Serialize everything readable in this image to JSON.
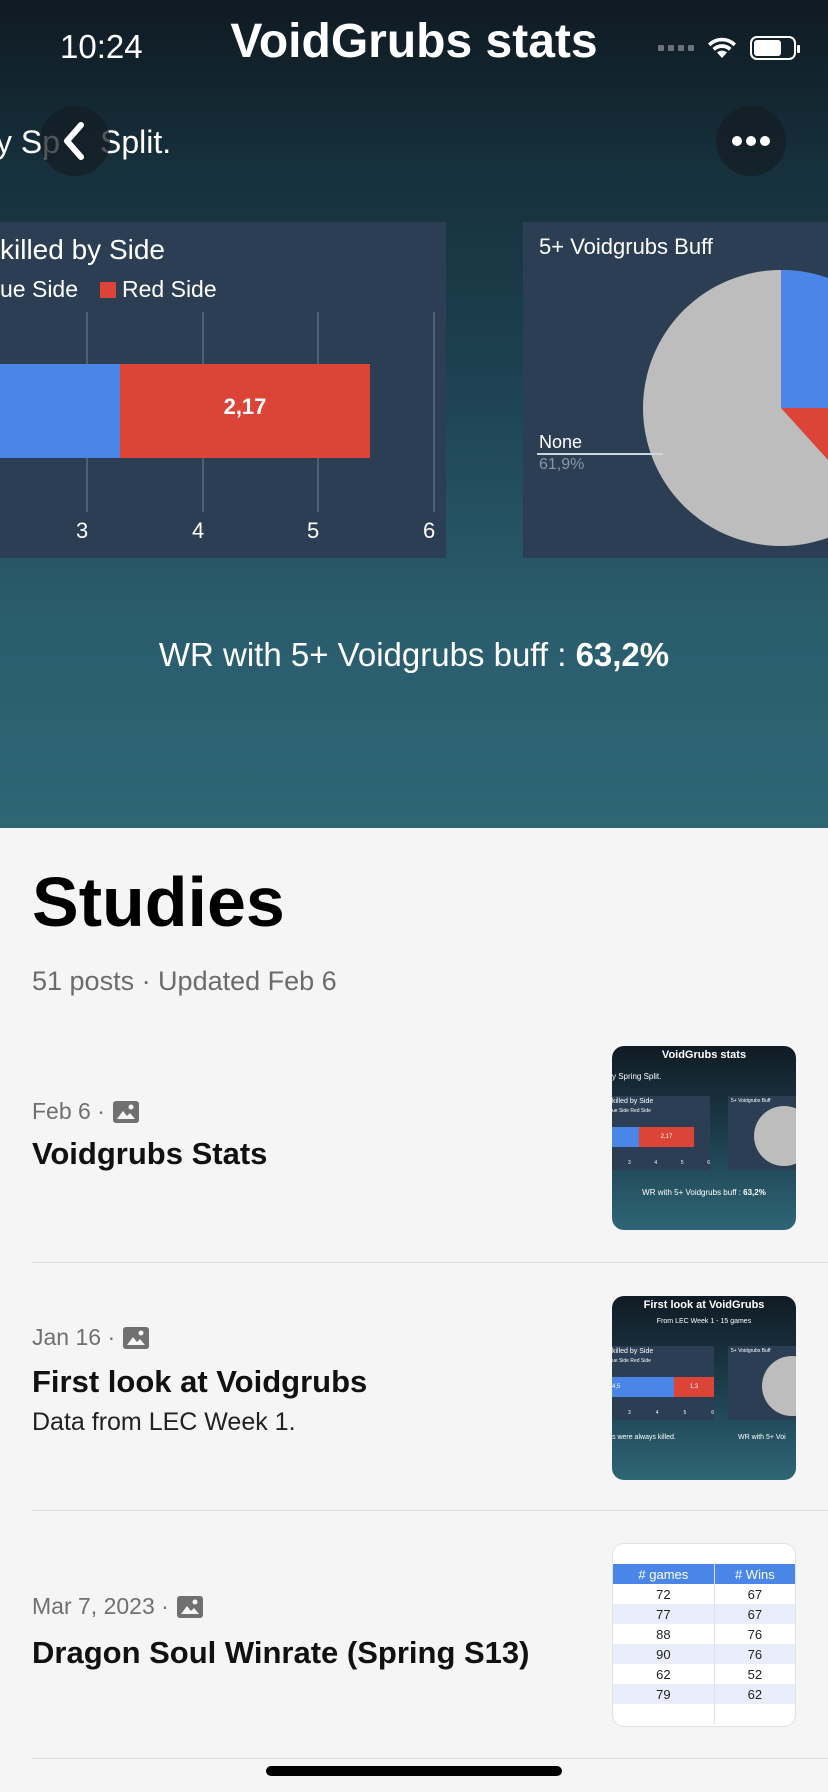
{
  "status": {
    "time": "10:24"
  },
  "hero": {
    "title": "VoidGrubs stats",
    "subtitle_fragment": "y Sp",
    "subtitle_tail": "Split.",
    "left_card": {
      "title": "killed by Side",
      "legend_left": "ue Side",
      "legend_right": "Red Side",
      "bar_value": "2,17",
      "ticks": [
        "3",
        "4",
        "5",
        "6"
      ]
    },
    "right_card": {
      "title": "5+ Voidgrubs Buff",
      "pie_label": "None",
      "pie_percent": "61,9%"
    },
    "wr_prefix": "WR with 5+ Voidgrubs buff : ",
    "wr_value": "63,2%"
  },
  "section": {
    "heading": "Studies",
    "meta": "51 posts · Updated Feb 6"
  },
  "posts": [
    {
      "date": "Feb 6 ·",
      "title": "Voidgrubs Stats",
      "description": "",
      "thumb": {
        "title": "VoidGrubs stats",
        "sub": "y Spring Split.",
        "card_title": "killed by Side",
        "legend": "ue Side",
        "legend_red": "Red Side",
        "bar_value": "2,17",
        "ticks": [
          "3",
          "4",
          "5",
          "6"
        ],
        "right_title": "5+ Voidgrubs Buff",
        "wr_prefix": "WR with 5+ Voidgrubs buff : ",
        "wr_value": "63,2%"
      }
    },
    {
      "date": "Jan 16 ·",
      "title": "First look at Voidgrubs",
      "description": "Data from LEC Week 1.",
      "thumb": {
        "title": "First look at VoidGrubs",
        "sub": "From LEC Week 1 - 15 games",
        "card_title": "killed by Side",
        "legend": "ue Side",
        "legend_red": "Red Side",
        "bar_blue": "4,5",
        "bar_value": "1,3",
        "ticks": [
          "3",
          "4",
          "5",
          "6"
        ],
        "right_title": "5+ Voidgrubs Buff",
        "left_note": "s were always killed.",
        "right_note": "WR with 5+ Voi"
      }
    },
    {
      "date": "Mar 7, 2023 ·",
      "title": "Dragon Soul Winrate (Spring S13)",
      "description": "",
      "table": {
        "headers": [
          "# games",
          "# Wins"
        ],
        "rows": [
          [
            "72",
            "67"
          ],
          [
            "77",
            "67"
          ],
          [
            "88",
            "76"
          ],
          [
            "90",
            "76"
          ],
          [
            "62",
            "52"
          ],
          [
            "79",
            "62"
          ],
          [
            "",
            ""
          ]
        ]
      }
    }
  ]
}
